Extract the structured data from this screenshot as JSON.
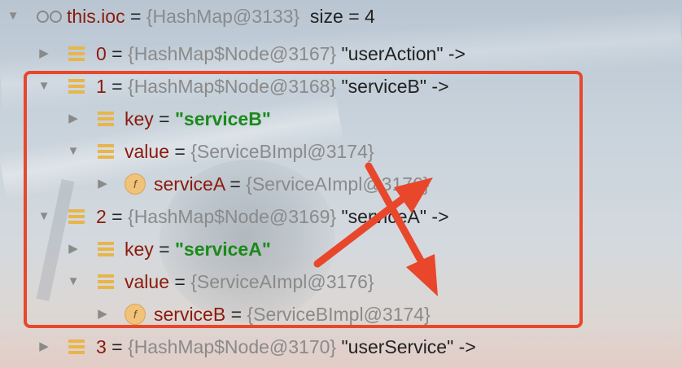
{
  "root": {
    "name": "this.ioc",
    "eq": " = ",
    "ref": "{HashMap@3133}",
    "extra": "size = 4"
  },
  "entries": [
    {
      "index": "0",
      "eq": " = ",
      "ref": "{HashMap$Node@3167}",
      "label": " \"userAction\" ->"
    },
    {
      "index": "1",
      "eq": " = ",
      "ref": "{HashMap$Node@3168}",
      "label": " \"serviceB\" ->",
      "key": {
        "name": "key",
        "eq": " = ",
        "value": "\"serviceB\""
      },
      "value": {
        "name": "value",
        "eq": " = ",
        "ref": "{ServiceBImpl@3174}"
      },
      "field": {
        "badge": "f",
        "name": "serviceA",
        "eq": " = ",
        "ref": "{ServiceAImpl@3176}"
      }
    },
    {
      "index": "2",
      "eq": " = ",
      "ref": "{HashMap$Node@3169}",
      "label": " \"serviceA\" ->",
      "key": {
        "name": "key",
        "eq": " = ",
        "value": "\"serviceA\""
      },
      "value": {
        "name": "value",
        "eq": " = ",
        "ref": "{ServiceAImpl@3176}"
      },
      "field": {
        "badge": "f",
        "name": "serviceB",
        "eq": " = ",
        "ref": "{ServiceBImpl@3174}"
      }
    },
    {
      "index": "3",
      "eq": " = ",
      "ref": "{HashMap$Node@3170}",
      "label": " \"userService\" ->"
    }
  ],
  "icons": {
    "expanded": "triangle-down",
    "collapsed": "triangle-right",
    "watch": "glasses",
    "entry": "stack-lines",
    "field": "field-f"
  },
  "colors": {
    "highlight": "#e8472c",
    "string_value": "#1a8a1a",
    "variable_name": "#8a1a0c",
    "reference": "#8a8a8a"
  }
}
